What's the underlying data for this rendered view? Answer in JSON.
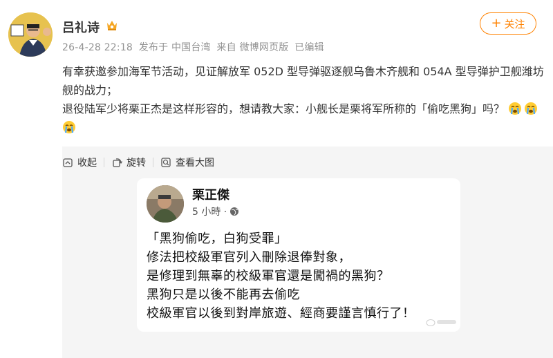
{
  "post": {
    "author": "吕礼诗",
    "meta": {
      "time": "26-4-28 22:18",
      "location": "发布于 中国台湾",
      "source": "来自 微博网页版",
      "edited": "已编辑"
    },
    "follow_label": "关注",
    "paragraphs": [
      "有幸获邀参加海军节活动，见证解放军 052D 型导弹驱逐舰乌鲁木齐舰和 054A 型导弹护卫舰潍坊舰的战力；",
      "退役陆军少将栗正杰是这样形容的，想请教大家：小舰长是栗将军所称的「偷吃黑狗」吗？"
    ],
    "emojis": [
      "crying-face",
      "crying-face",
      "crying-face"
    ]
  },
  "toolbar": {
    "collapse": "收起",
    "rotate": "旋转",
    "view_large": "查看大图"
  },
  "embedded": {
    "name": "栗正傑",
    "time": "5 小時 ·",
    "lines": [
      "「黑狗偷吃，白狗受罪」",
      "修法把校級軍官列入刪除退俸對象，",
      "是修理到無辜的校級軍官還是闖禍的黑狗？",
      "黑狗只是以後不能再去偷吃",
      "校級軍官以後到對岸旅遊、經商要謹言慎行了！"
    ]
  },
  "colors": {
    "accent": "#ff8200",
    "meta_gray": "#939393",
    "panel_bg": "#f5f5f5"
  }
}
